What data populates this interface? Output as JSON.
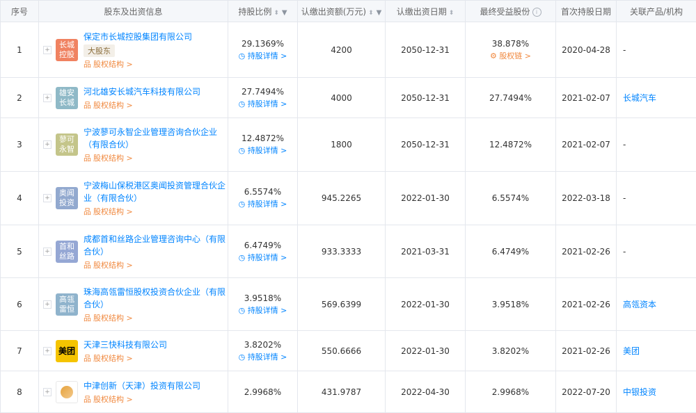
{
  "headers": {
    "seq": "序号",
    "shareholder": "股东及出资信息",
    "ratio": "持股比例",
    "amount": "认缴出资额(万元)",
    "date": "认缴出资日期",
    "final": "最终受益股份",
    "first": "首次持股日期",
    "related": "关联产品/机构"
  },
  "labels": {
    "equity": "股权结构 >",
    "detail": "持股详情 >",
    "chain": "股权链 >",
    "major": "大股东"
  },
  "colors": {
    "link": "#0084ff",
    "orange": "#f0883e"
  },
  "rows": [
    {
      "seq": "1",
      "logo": [
        "长城",
        "控股"
      ],
      "logo_color": "#f08261",
      "name": "保定市长城控股集团有限公司",
      "major": true,
      "ratio": "29.1369%",
      "detail": true,
      "amount": "4200",
      "date": "2050-12-31",
      "final": "38.878%",
      "chain": true,
      "first": "2020-04-28",
      "related": "-",
      "related_link": false
    },
    {
      "seq": "2",
      "logo": [
        "雄安",
        "长城"
      ],
      "logo_color": "#8fb9c7",
      "name": "河北雄安长城汽车科技有限公司",
      "major": false,
      "ratio": "27.7494%",
      "detail": true,
      "amount": "4000",
      "date": "2050-12-31",
      "final": "27.7494%",
      "chain": false,
      "first": "2021-02-07",
      "related": "长城汽车",
      "related_link": true
    },
    {
      "seq": "3",
      "logo": [
        "蓼可",
        "永智"
      ],
      "logo_color": "#c4c58a",
      "name": "宁波蓼可永智企业管理咨询合伙企业（有限合伙）",
      "major": false,
      "ratio": "12.4872%",
      "detail": true,
      "amount": "1800",
      "date": "2050-12-31",
      "final": "12.4872%",
      "chain": false,
      "first": "2021-02-07",
      "related": "-",
      "related_link": false
    },
    {
      "seq": "4",
      "logo": [
        "奥闻",
        "投资"
      ],
      "logo_color": "#92a9cf",
      "name": "宁波梅山保税港区奥闻投资管理合伙企业（有限合伙）",
      "major": false,
      "ratio": "6.5574%",
      "detail": true,
      "amount": "945.2265",
      "date": "2022-01-30",
      "final": "6.5574%",
      "chain": false,
      "first": "2022-03-18",
      "related": "-",
      "related_link": false
    },
    {
      "seq": "5",
      "logo": [
        "首和",
        "丝路"
      ],
      "logo_color": "#95a7d4",
      "name": "成都首和丝路企业管理咨询中心（有限合伙）",
      "major": false,
      "ratio": "6.4749%",
      "detail": true,
      "amount": "933.3333",
      "date": "2021-03-31",
      "final": "6.4749%",
      "chain": false,
      "first": "2021-02-26",
      "related": "-",
      "related_link": false
    },
    {
      "seq": "6",
      "logo": [
        "高瓴",
        "雷恒"
      ],
      "logo_color": "#8fb3cc",
      "name": "珠海高瓴雷恒股权投资合伙企业（有限合伙）",
      "major": false,
      "ratio": "3.9518%",
      "detail": true,
      "amount": "569.6399",
      "date": "2022-01-30",
      "final": "3.9518%",
      "chain": false,
      "first": "2021-02-26",
      "related": "高瓴资本",
      "related_link": true
    },
    {
      "seq": "7",
      "logo": [
        "美团"
      ],
      "logo_color": "#f5c400",
      "name": "天津三快科技有限公司",
      "major": false,
      "ratio": "3.8202%",
      "detail": true,
      "amount": "550.6666",
      "date": "2022-01-30",
      "final": "3.8202%",
      "chain": false,
      "first": "2021-02-26",
      "related": "美团",
      "related_link": true
    },
    {
      "seq": "8",
      "logo": [],
      "logo_color": "#ffffff",
      "name": "中津创新（天津）投资有限公司",
      "major": false,
      "ratio": "2.9968%",
      "detail": false,
      "amount": "431.9787",
      "date": "2022-04-30",
      "final": "2.9968%",
      "chain": false,
      "first": "2022-07-20",
      "related": "中银投资",
      "related_link": true
    }
  ]
}
